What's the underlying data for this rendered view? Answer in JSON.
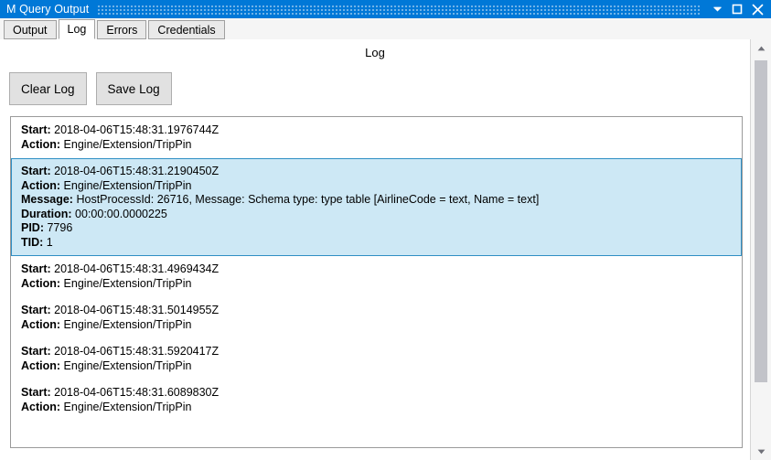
{
  "window": {
    "title": "M Query Output",
    "controls": [
      {
        "name": "minimize-button",
        "icon": "chevron-down-icon",
        "label": "Minimize"
      },
      {
        "name": "maximize-button",
        "icon": "square-icon",
        "label": "Maximize"
      },
      {
        "name": "close-button",
        "icon": "close-icon",
        "label": "Close"
      }
    ]
  },
  "tabs": [
    {
      "label": "Output",
      "active": false
    },
    {
      "label": "Log",
      "active": true
    },
    {
      "label": "Errors",
      "active": false
    },
    {
      "label": "Credentials",
      "active": false
    }
  ],
  "page": {
    "title": "Log"
  },
  "toolbar": {
    "clear_log_label": "Clear Log",
    "save_log_label": "Save Log"
  },
  "labels": {
    "start": "Start:",
    "action": "Action:",
    "message": "Message:",
    "duration": "Duration:",
    "pid": "PID:",
    "tid": "TID:"
  },
  "log_entries": [
    {
      "selected": false,
      "start": "2018-04-06T15:48:31.1976744Z",
      "action": "Engine/Extension/TripPin"
    },
    {
      "selected": true,
      "start": "2018-04-06T15:48:31.2190450Z",
      "action": "Engine/Extension/TripPin",
      "message": "HostProcessId: 26716, Message: Schema type: type table [AirlineCode = text, Name = text]",
      "duration": "00:00:00.0000225",
      "pid": "7796",
      "tid": "1"
    },
    {
      "selected": false,
      "start": "2018-04-06T15:48:31.4969434Z",
      "action": "Engine/Extension/TripPin"
    },
    {
      "selected": false,
      "start": "2018-04-06T15:48:31.5014955Z",
      "action": "Engine/Extension/TripPin"
    },
    {
      "selected": false,
      "start": "2018-04-06T15:48:31.5920417Z",
      "action": "Engine/Extension/TripPin"
    },
    {
      "selected": false,
      "start": "2018-04-06T15:48:31.6089830Z",
      "action": "Engine/Extension/TripPin"
    }
  ],
  "scrollbar": {
    "up_arrow": "scroll-up-arrow-icon",
    "down_arrow": "scroll-down-arrow-icon"
  },
  "colors": {
    "titlebar": "#0078d7",
    "selection_background": "#cde8f5",
    "selection_border": "#2f8fc4",
    "button_face": "#e1e1e1"
  }
}
